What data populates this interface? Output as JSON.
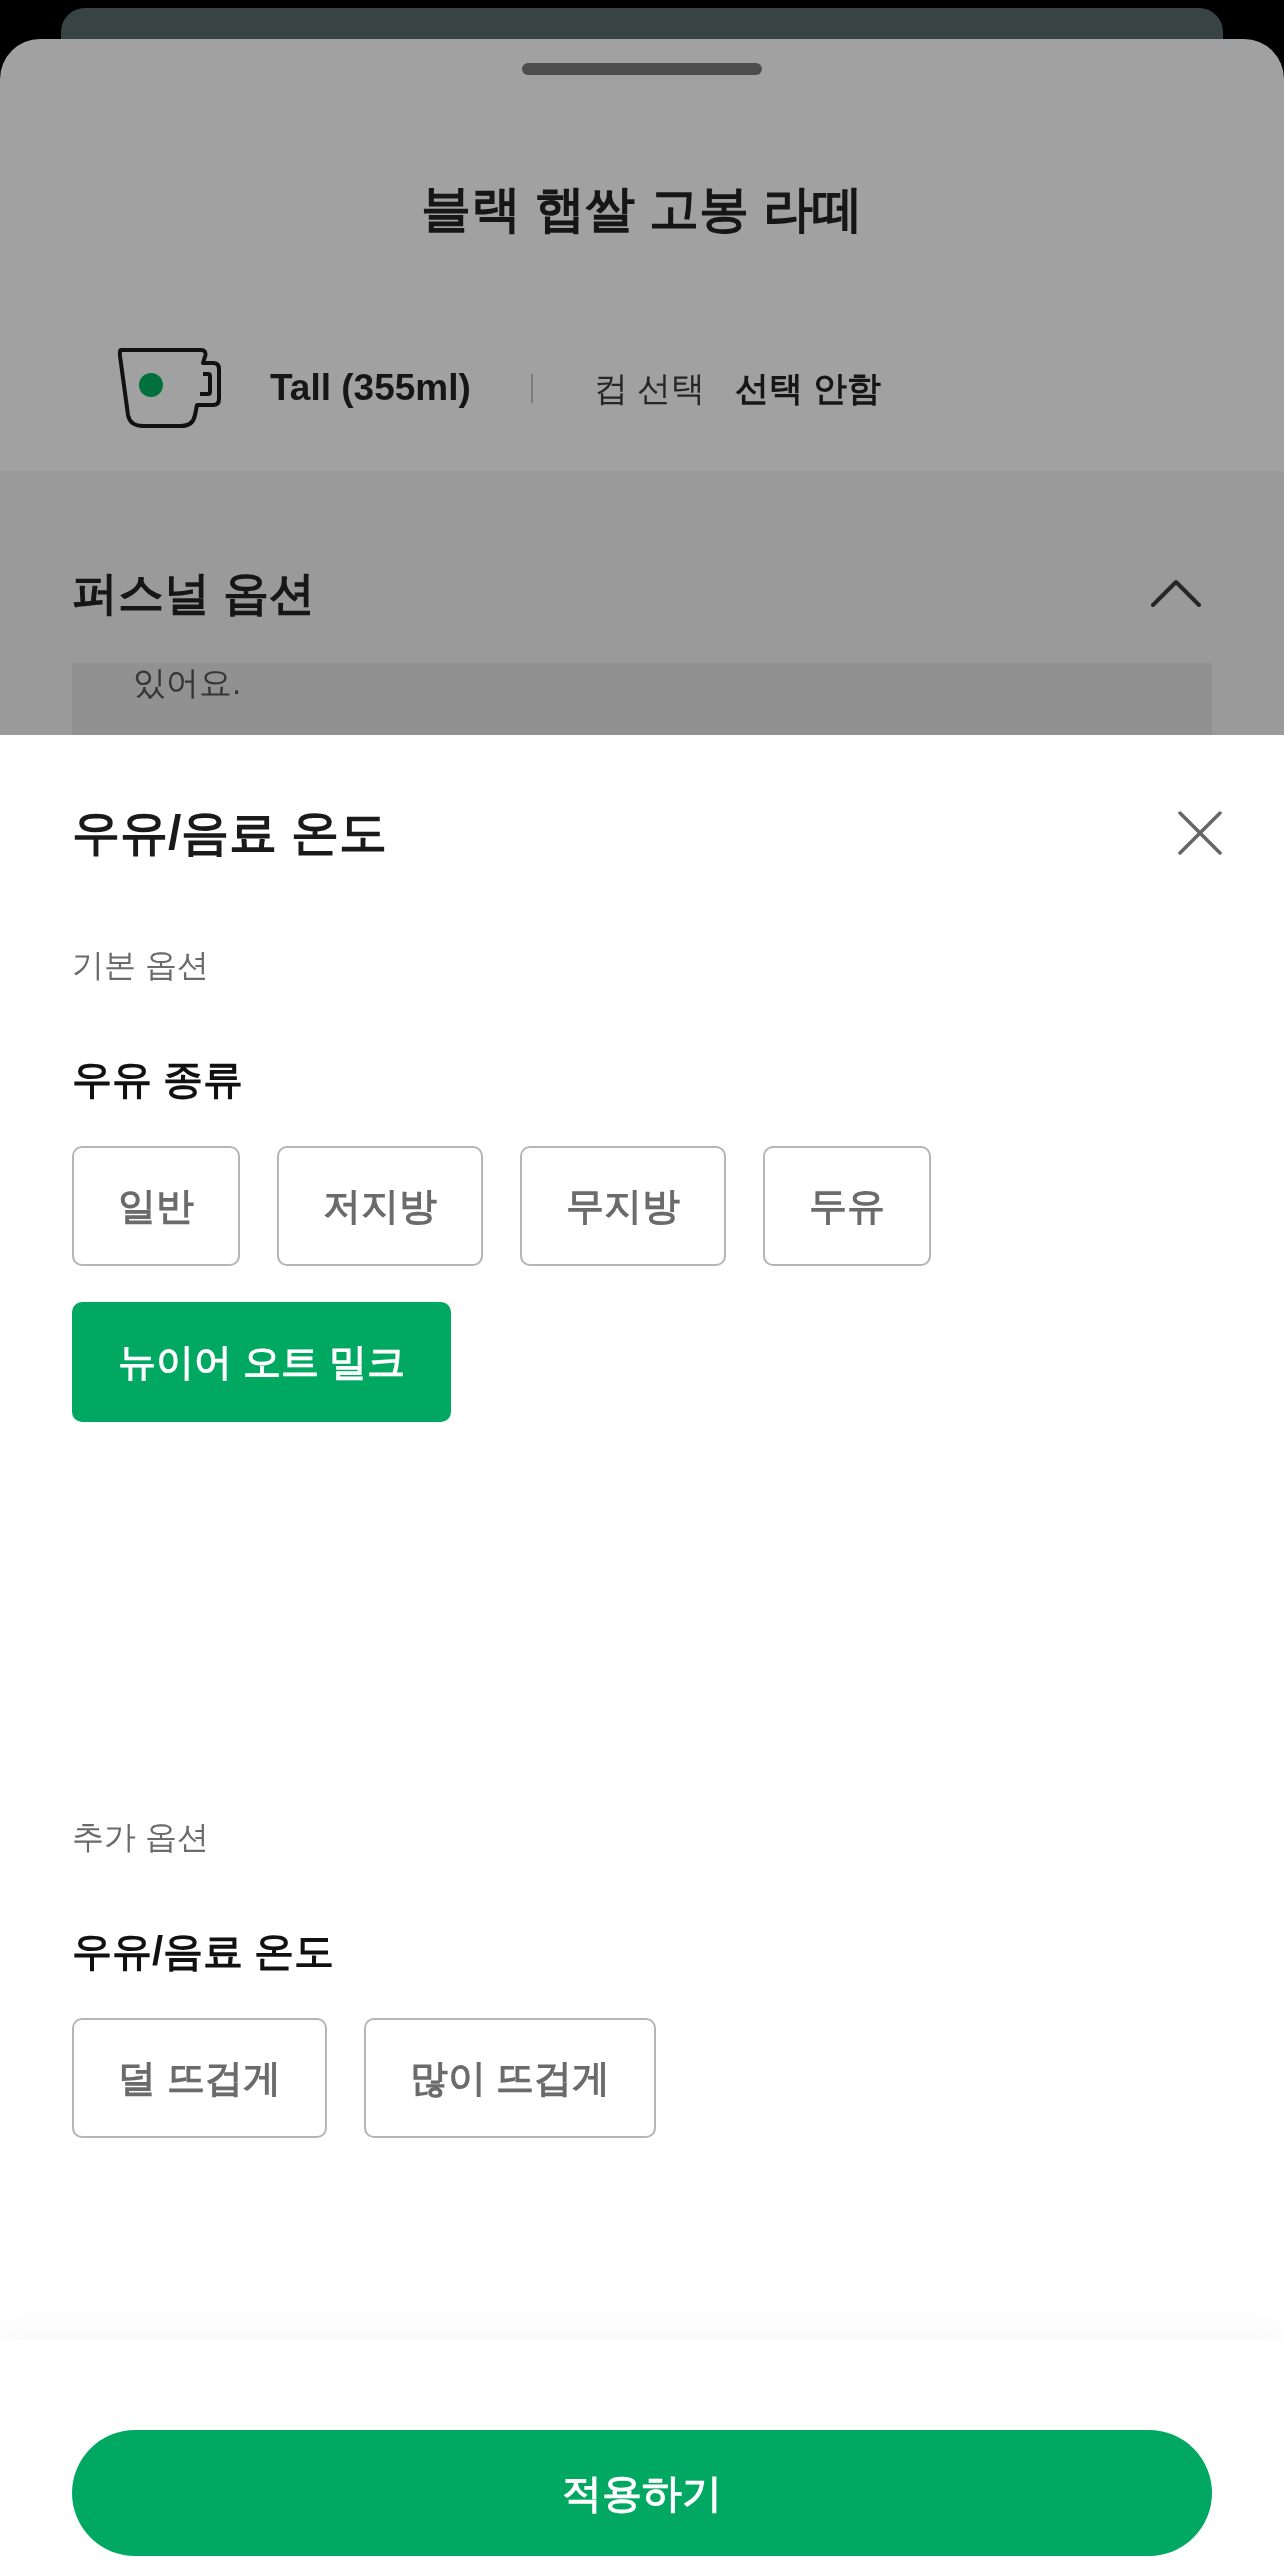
{
  "background_screen": {
    "title": "블랙 햅쌀 고봉 라떼",
    "size": "Tall (355ml)",
    "cup_label": "컵 선택",
    "cup_value": "선택 안함",
    "personal_option": {
      "title": "퍼스널 옵션",
      "expanded": true,
      "preview_text": "있어요."
    }
  },
  "sheet": {
    "title": "우유/음료 온도",
    "groups": [
      {
        "label": "기본 옵션",
        "heading": "우유 종류",
        "options": [
          {
            "label": "일반",
            "selected": false
          },
          {
            "label": "저지방",
            "selected": false
          },
          {
            "label": "무지방",
            "selected": false
          },
          {
            "label": "두유",
            "selected": false
          },
          {
            "label": "뉴이어 오트 밀크",
            "selected": true
          }
        ]
      },
      {
        "label": "추가 옵션",
        "heading": "우유/음료 온도",
        "options": [
          {
            "label": "덜 뜨겁게",
            "selected": false
          },
          {
            "label": "많이 뜨겁게",
            "selected": false
          }
        ]
      }
    ],
    "apply_button": "적용하기"
  }
}
